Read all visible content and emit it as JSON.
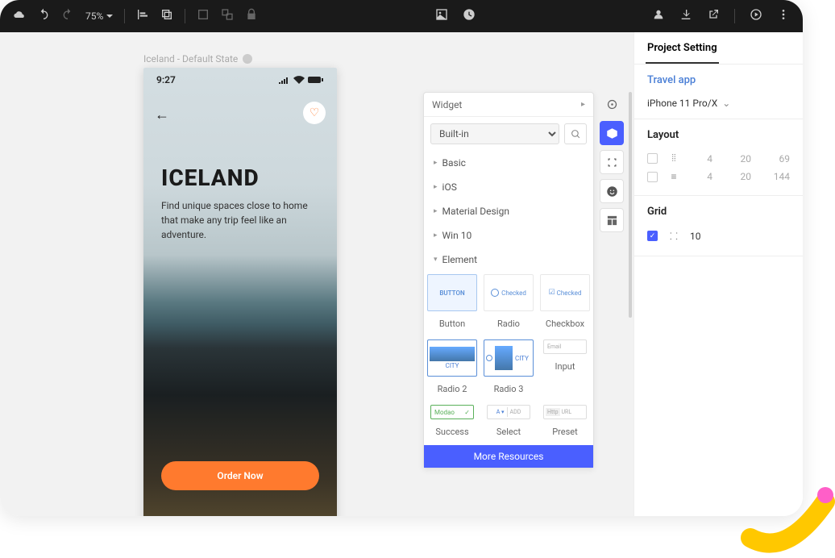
{
  "topbar": {
    "zoom": "75%"
  },
  "artboard": {
    "label": "Iceland - Default State"
  },
  "phone": {
    "time": "9:27",
    "title": "ICELAND",
    "subtitle": "Find unique spaces close to home that make any trip feel like an adventure.",
    "cta": "Order Now"
  },
  "widget": {
    "header": "Widget",
    "library": "Built-in",
    "categories": [
      "Basic",
      "iOS",
      "Material Design",
      "Win 10",
      "Element"
    ],
    "items": [
      {
        "label": "Button",
        "preview": "BUTTON"
      },
      {
        "label": "Radio",
        "preview": "Checked"
      },
      {
        "label": "Checkbox",
        "preview": "Checked"
      },
      {
        "label": "Radio 2",
        "preview": "CITY"
      },
      {
        "label": "Radio 3",
        "preview": "CITY"
      },
      {
        "label": "Input",
        "preview": "Email"
      },
      {
        "label": "Success",
        "preview": "Modao"
      },
      {
        "label": "Select",
        "preview": "ADD"
      },
      {
        "label": "Preset",
        "preview": "URL"
      }
    ],
    "more": "More Resources"
  },
  "right": {
    "header": "Project Setting",
    "app": "Travel app",
    "device": "iPhone 11 Pro/X",
    "layout_title": "Layout",
    "layout_rows": [
      {
        "checked": false,
        "v1": "4",
        "v2": "20",
        "v3": "69"
      },
      {
        "checked": false,
        "v1": "4",
        "v2": "20",
        "v3": "144"
      }
    ],
    "grid_title": "Grid",
    "grid_value": "10"
  }
}
